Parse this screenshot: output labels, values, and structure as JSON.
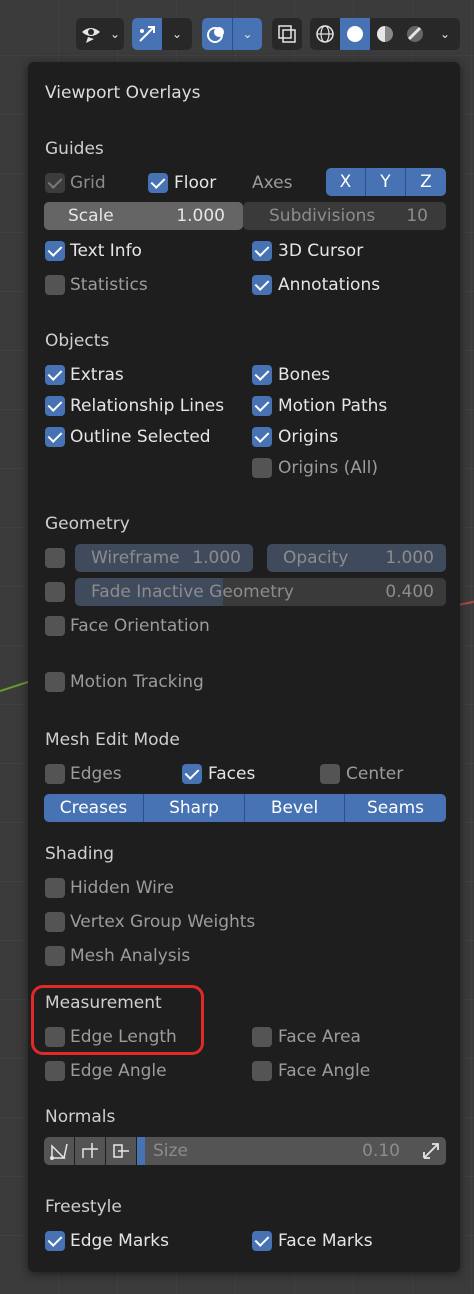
{
  "toolbar": {
    "icons": [
      "eye-visibility-icon",
      "chevron-down-icon",
      "gizmo-icon",
      "chevron-down-icon",
      "overlays-icon",
      "chevron-down-icon",
      "xray-icon",
      "wireframe-shading-icon",
      "solid-shading-icon",
      "material-shading-icon",
      "rendered-shading-icon",
      "chevron-down-icon"
    ]
  },
  "panel": {
    "title": "Viewport Overlays",
    "guides": {
      "heading": "Guides",
      "grid": {
        "label": "Grid",
        "checked": true,
        "enabled": false
      },
      "floor": {
        "label": "Floor",
        "checked": true
      },
      "axes_label": "Axes",
      "axes": [
        "X",
        "Y",
        "Z"
      ],
      "scale_label": "Scale",
      "scale_value": "1.000",
      "subdivisions_label": "Subdivisions",
      "subdivisions_value": "10",
      "text_info": {
        "label": "Text Info",
        "checked": true
      },
      "cursor_3d": {
        "label": "3D Cursor",
        "checked": true
      },
      "statistics": {
        "label": "Statistics",
        "checked": false
      },
      "annotations": {
        "label": "Annotations",
        "checked": true
      }
    },
    "objects": {
      "heading": "Objects",
      "extras": {
        "label": "Extras",
        "checked": true
      },
      "bones": {
        "label": "Bones",
        "checked": true
      },
      "relationship_lines": {
        "label": "Relationship Lines",
        "checked": true
      },
      "motion_paths": {
        "label": "Motion Paths",
        "checked": true
      },
      "outline_selected": {
        "label": "Outline Selected",
        "checked": true
      },
      "origins": {
        "label": "Origins",
        "checked": true
      },
      "origins_all": {
        "label": "Origins (All)",
        "checked": false
      }
    },
    "geometry": {
      "heading": "Geometry",
      "wireframe_label": "Wireframe",
      "wireframe_value": "1.000",
      "opacity_label": "Opacity",
      "opacity_value": "1.000",
      "fade_label": "Fade Inactive Geometry",
      "fade_value": "0.400",
      "fade_level": 0.4,
      "face_orientation": {
        "label": "Face Orientation",
        "checked": false
      }
    },
    "motion_tracking": {
      "label": "Motion Tracking",
      "checked": false
    },
    "mesh_edit": {
      "heading": "Mesh Edit Mode",
      "edges": {
        "label": "Edges",
        "checked": false
      },
      "faces": {
        "label": "Faces",
        "checked": true
      },
      "center": {
        "label": "Center",
        "checked": false
      },
      "buttons": [
        "Creases",
        "Sharp",
        "Bevel",
        "Seams"
      ]
    },
    "shading": {
      "heading": "Shading",
      "hidden_wire": {
        "label": "Hidden Wire",
        "checked": false
      },
      "vertex_group_weights": {
        "label": "Vertex Group Weights",
        "checked": false
      },
      "mesh_analysis": {
        "label": "Mesh Analysis",
        "checked": false
      }
    },
    "measurement": {
      "heading": "Measurement",
      "edge_length": {
        "label": "Edge Length",
        "checked": false
      },
      "face_area": {
        "label": "Face Area",
        "checked": false
      },
      "edge_angle": {
        "label": "Edge Angle",
        "checked": false
      },
      "face_angle": {
        "label": "Face Angle",
        "checked": false
      }
    },
    "normals": {
      "heading": "Normals",
      "size_label": "Size",
      "size_value": "0.10",
      "icons": [
        "vertex-normals-icon",
        "split-normals-icon",
        "face-normals-icon",
        "constant-screen-size-icon"
      ]
    },
    "freestyle": {
      "heading": "Freestyle",
      "edge_marks": {
        "label": "Edge Marks",
        "checked": true
      },
      "face_marks": {
        "label": "Face Marks",
        "checked": true
      }
    }
  },
  "colors": {
    "accent": "#4772b3",
    "panel_bg": "#1e1e1e",
    "highlight": "#e02a2a"
  }
}
